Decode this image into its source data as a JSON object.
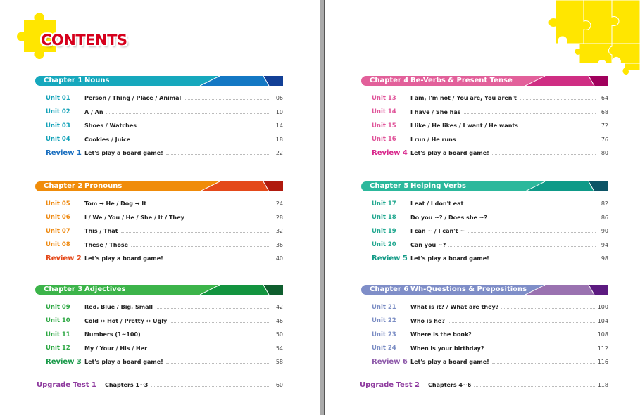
{
  "title": "CONTENTS",
  "colors": {
    "title": "#d6001c",
    "puzzle": "#ffe600",
    "spine": "#aaaaaa"
  },
  "chapters": [
    {
      "label": "Chapter 1",
      "title": "Nouns",
      "colors": {
        "main": "#16a8bd",
        "mid": "#1478c4",
        "dark": "#123f96",
        "text": "#14a2b8",
        "review": "#1a6fc0"
      },
      "entries": [
        {
          "label": "Unit 01",
          "title": "Person / Thing / Place / Animal",
          "page": "06"
        },
        {
          "label": "Unit 02",
          "title": "A / An",
          "page": "10"
        },
        {
          "label": "Unit 03",
          "title": "Shoes / Watches",
          "page": "14"
        },
        {
          "label": "Unit 04",
          "title": "Cookies / Juice",
          "page": "18"
        },
        {
          "label": "Review 1",
          "title": "Let's play a board game!",
          "page": "22",
          "review": true
        }
      ]
    },
    {
      "label": "Chapter 2",
      "title": "Pronouns",
      "colors": {
        "main": "#f08c0a",
        "mid": "#e4491a",
        "dark": "#b01a0e",
        "text": "#ee8a12",
        "review": "#e4491a"
      },
      "entries": [
        {
          "label": "Unit 05",
          "title": "Tom → He / Dog → It",
          "page": "24"
        },
        {
          "label": "Unit 06",
          "title": "I / We / You / He / She / It / They",
          "page": "28"
        },
        {
          "label": "Unit 07",
          "title": "This / That",
          "page": "32"
        },
        {
          "label": "Unit 08",
          "title": "These / Those",
          "page": "36"
        },
        {
          "label": "Review 2",
          "title": "Let's play a board game!",
          "page": "40",
          "review": true
        }
      ]
    },
    {
      "label": "Chapter 3",
      "title": "Adjectives",
      "colors": {
        "main": "#3cb44a",
        "mid": "#13943f",
        "dark": "#0f5e2e",
        "text": "#2ea844",
        "review": "#1a9a4a"
      },
      "entries": [
        {
          "label": "Unit 09",
          "title": "Red, Blue / Big, Small",
          "page": "42"
        },
        {
          "label": "Unit 10",
          "title": "Cold ↔ Hot / Pretty ↔ Ugly",
          "page": "46"
        },
        {
          "label": "Unit 11",
          "title": "Numbers (1~100)",
          "page": "50"
        },
        {
          "label": "Unit 12",
          "title": "My / Your / His / Her",
          "page": "54"
        },
        {
          "label": "Review 3",
          "title": "Let's play a board game!",
          "page": "58",
          "review": true
        }
      ]
    },
    {
      "label": "Chapter 4",
      "title": "Be-Verbs & Present Tense",
      "colors": {
        "main": "#e2609a",
        "mid": "#cf2e83",
        "dark": "#a0005c",
        "text": "#e0559a",
        "review": "#d8278c"
      },
      "entries": [
        {
          "label": "Unit 13",
          "title": "I am, I'm not / You are, You aren't",
          "page": "64"
        },
        {
          "label": "Unit 14",
          "title": "I have / She has",
          "page": "68"
        },
        {
          "label": "Unit 15",
          "title": "I like / He likes / I want / He wants",
          "page": "72"
        },
        {
          "label": "Unit 16",
          "title": "I run / He runs",
          "page": "76"
        },
        {
          "label": "Review 4",
          "title": "Let's play a board game!",
          "page": "80",
          "review": true
        }
      ]
    },
    {
      "label": "Chapter 5",
      "title": "Helping Verbs",
      "colors": {
        "main": "#2cb89c",
        "mid": "#0e9a88",
        "dark": "#0c5466",
        "text": "#22a890",
        "review": "#139a86"
      },
      "entries": [
        {
          "label": "Unit 17",
          "title": "I eat / I don't eat",
          "page": "82"
        },
        {
          "label": "Unit 18",
          "title": "Do you ~? / Does she ~?",
          "page": "86"
        },
        {
          "label": "Unit 19",
          "title": "I can ~ / I can't ~",
          "page": "90"
        },
        {
          "label": "Unit 20",
          "title": "Can you ~?",
          "page": "94"
        },
        {
          "label": "Review 5",
          "title": "Let's play a board game!",
          "page": "98",
          "review": true
        }
      ]
    },
    {
      "label": "Chapter 6",
      "title": "Wh-Questions & Prepositions",
      "colors": {
        "main": "#7f8ec8",
        "mid": "#9a72b0",
        "dark": "#5c1a80",
        "text": "#7b8dc4",
        "review": "#8e5aaa"
      },
      "entries": [
        {
          "label": "Unit 21",
          "title": "What is it? / What are they?",
          "page": "100"
        },
        {
          "label": "Unit 22",
          "title": "Who is he?",
          "page": "104"
        },
        {
          "label": "Unit 23",
          "title": "Where is the book?",
          "page": "108"
        },
        {
          "label": "Unit 24",
          "title": "When is your birthday?",
          "page": "112"
        },
        {
          "label": "Review 6",
          "title": "Let's play a board game!",
          "page": "116",
          "review": true
        }
      ]
    }
  ],
  "upgrade_tests": [
    {
      "label": "Upgrade Test 1",
      "title": "Chapters 1~3",
      "page": "60"
    },
    {
      "label": "Upgrade Test 2",
      "title": "Chapters 4~6",
      "page": "118"
    }
  ]
}
